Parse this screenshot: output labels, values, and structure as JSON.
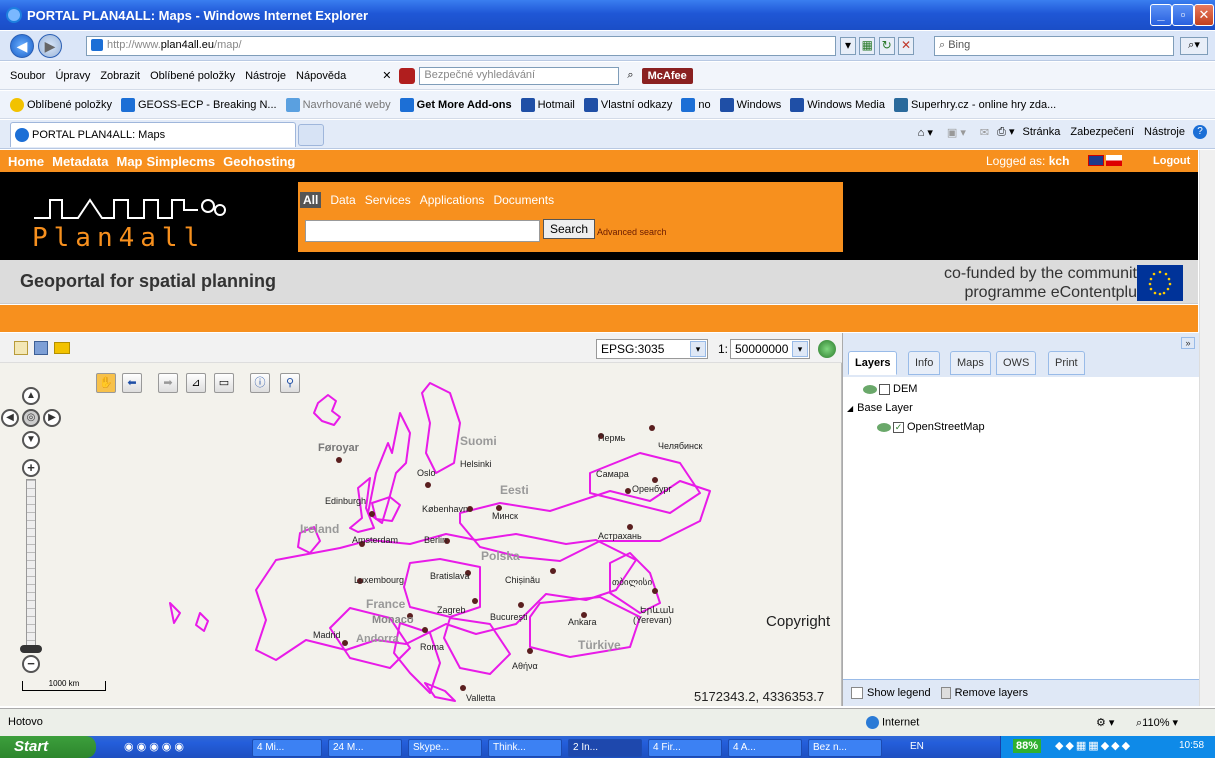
{
  "window": {
    "title": "PORTAL PLAN4ALL: Maps - Windows Internet Explorer"
  },
  "address": {
    "url_prefix": "http://www.",
    "url_domain": "plan4all.eu",
    "url_path": "/map/",
    "search_placeholder": "Bing"
  },
  "menu": {
    "items": [
      "Soubor",
      "Úpravy",
      "Zobrazit",
      "Oblíbené položky",
      "Nástroje",
      "Nápověda"
    ],
    "safe_search_placeholder": "Bezpečné vyhledávání",
    "mcafee": "McAfee"
  },
  "favorites": {
    "label": "Oblíbené položky",
    "items": [
      "GEOSS-ECP - Breaking N...",
      "Navrhované weby",
      "Get More Add-ons",
      "Hotmail",
      "Vlastní odkazy",
      "no",
      "Windows",
      "Windows Media",
      "Superhry.cz - online hry zda..."
    ]
  },
  "tab": {
    "title": "PORTAL PLAN4ALL: Maps"
  },
  "commandbar": {
    "page": "Stránka",
    "security": "Zabezpečení",
    "tools": "Nástroje"
  },
  "portal": {
    "nav": [
      "Home",
      "Metadata",
      "Map",
      "Simplecms",
      "Geohosting"
    ],
    "logged_as_label": "Logged as:",
    "user": "kch",
    "logout": "Logout",
    "logo_text": "Plan4all",
    "search_tabs": [
      "All",
      "Data",
      "Services",
      "Applications",
      "Documents"
    ],
    "search_button": "Search",
    "advanced_search": "Advanced search",
    "slogan": "Geoportal for spatial planning",
    "cofunded_line1": "co-funded by the community",
    "cofunded_line2": "programme eContentplus"
  },
  "map": {
    "projection": "EPSG:3035",
    "scale_prefix": "1:",
    "scale": "50000000",
    "copyright": "Copyright",
    "coordinates": "5172343.2, 4336353.7",
    "scalebar": "1000 km",
    "labels": [
      "Føroyar",
      "Suomi",
      "Пермь",
      "Челябинск",
      "Oslo",
      "Helsinki",
      "Самара",
      "Оренбург",
      "Edinburgh",
      "Eesti",
      "København",
      "Минск",
      "Ireland",
      "Amsterdam",
      "Berlin",
      "Астрахань",
      "Polska",
      "Luxembourg",
      "Bratislava",
      "Chișinău",
      "თბილისი",
      "France",
      "Monaco",
      "Zagreb",
      "București",
      "Երևան",
      "(Yerevan)",
      "Madrid",
      "Andorra",
      "Roma",
      "Ankara",
      "Türkiye",
      "Αθήνα",
      "Valletta"
    ]
  },
  "panel": {
    "tabs": [
      "Layers",
      "Info",
      "Maps",
      "OWS",
      "Print"
    ],
    "layers": {
      "dem": "DEM",
      "group": "Base Layer",
      "osm": "OpenStreetMap"
    },
    "show_legend": "Show legend",
    "remove_layers": "Remove layers"
  },
  "status": {
    "left": "Hotovo",
    "zone": "Internet",
    "zoom": "110%"
  },
  "taskbar": {
    "start": "Start",
    "items": [
      "4 Mi...",
      "24 M...",
      "Skype...",
      "Think...",
      "2 In...",
      "4 Fir...",
      "4 A...",
      "Bez n..."
    ],
    "lang": "EN",
    "battery": "88%",
    "clock": "10:58"
  },
  "colors": {
    "orange": "#f7901e",
    "border": "#e81be8",
    "city": "#5a1f1f"
  }
}
